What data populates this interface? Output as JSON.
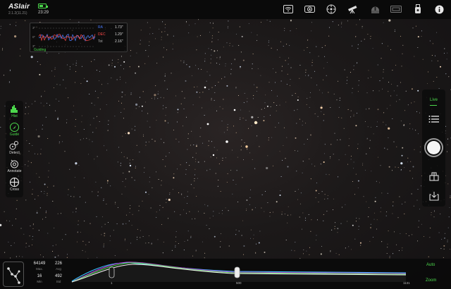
{
  "app": {
    "name": "ASIair",
    "version": "2.1.2(11.21)"
  },
  "status": {
    "battery_level": 0.55,
    "time": "23:29"
  },
  "toolbar_icons": [
    "wifi-icon",
    "camera-icon",
    "focuser-icon",
    "telescope-icon",
    "observatory-icon",
    "filter-wheel-icon",
    "usb-drive-icon",
    "info-icon"
  ],
  "guide": {
    "label": "Guiding",
    "ra_label": "RA",
    "ra_value": "1.73\"",
    "dec_label": "DEC",
    "dec_value": "1.29\"",
    "tot_label": "Tot",
    "tot_value": "2.16\"",
    "ra_color": "#4a7cff",
    "dec_color": "#ff4a4a"
  },
  "left_tools": [
    {
      "label": "Hist",
      "icon": "histogram-icon"
    },
    {
      "label": "Guide",
      "icon": "guide-icon"
    },
    {
      "label": "Detect",
      "icon": "detect-icon"
    },
    {
      "label": "Annotate",
      "icon": "annotate-icon"
    },
    {
      "label": "Cross",
      "icon": "crosshair-icon"
    }
  ],
  "right_panel": {
    "mode": "Live"
  },
  "stats": {
    "max": "64149",
    "max_label": "Max.",
    "avg": "226",
    "avg_label": "Avg",
    "min": "16",
    "min_label": "Min",
    "std": "492",
    "std_label": "Std"
  },
  "histogram": {
    "left_stretch": "1",
    "mid_stretch": "500",
    "right_stretch": "1131",
    "auto_label": "Auto",
    "zoom_label": "Zoom"
  },
  "colors": {
    "accent": "#4cd94c"
  }
}
